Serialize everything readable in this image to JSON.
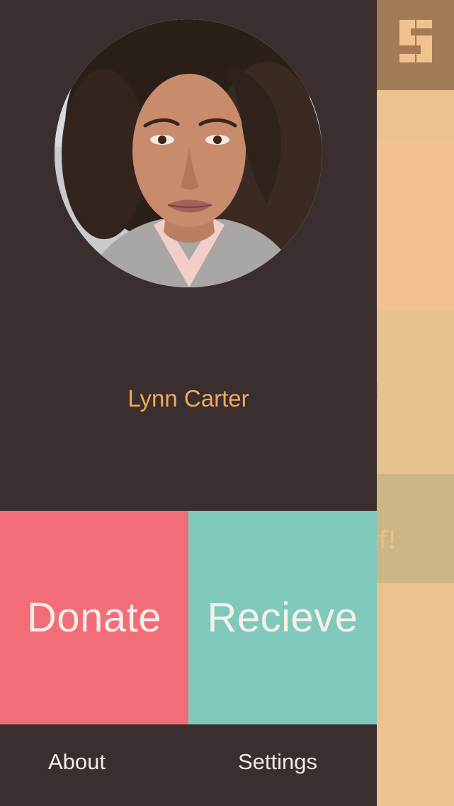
{
  "colors": {
    "drawer_bg": "#3a2e2e",
    "name_accent": "#f0a95c",
    "donate_bg": "#f26d78",
    "receive_bg": "#7fc9bc",
    "header_bg": "#a27b57",
    "content_bg": "#f2c190"
  },
  "background_app": {
    "logo_icon": "s-logo-icon",
    "tab_label_partial": "lic",
    "card_text_partial": "roof!"
  },
  "drawer": {
    "avatar_icon": "user-avatar-photo",
    "user_name": "Lynn Carter",
    "actions": {
      "donate_label": "Donate",
      "receive_label": "Recieve"
    },
    "nav": {
      "about_label": "About",
      "settings_label": "Settings"
    }
  }
}
